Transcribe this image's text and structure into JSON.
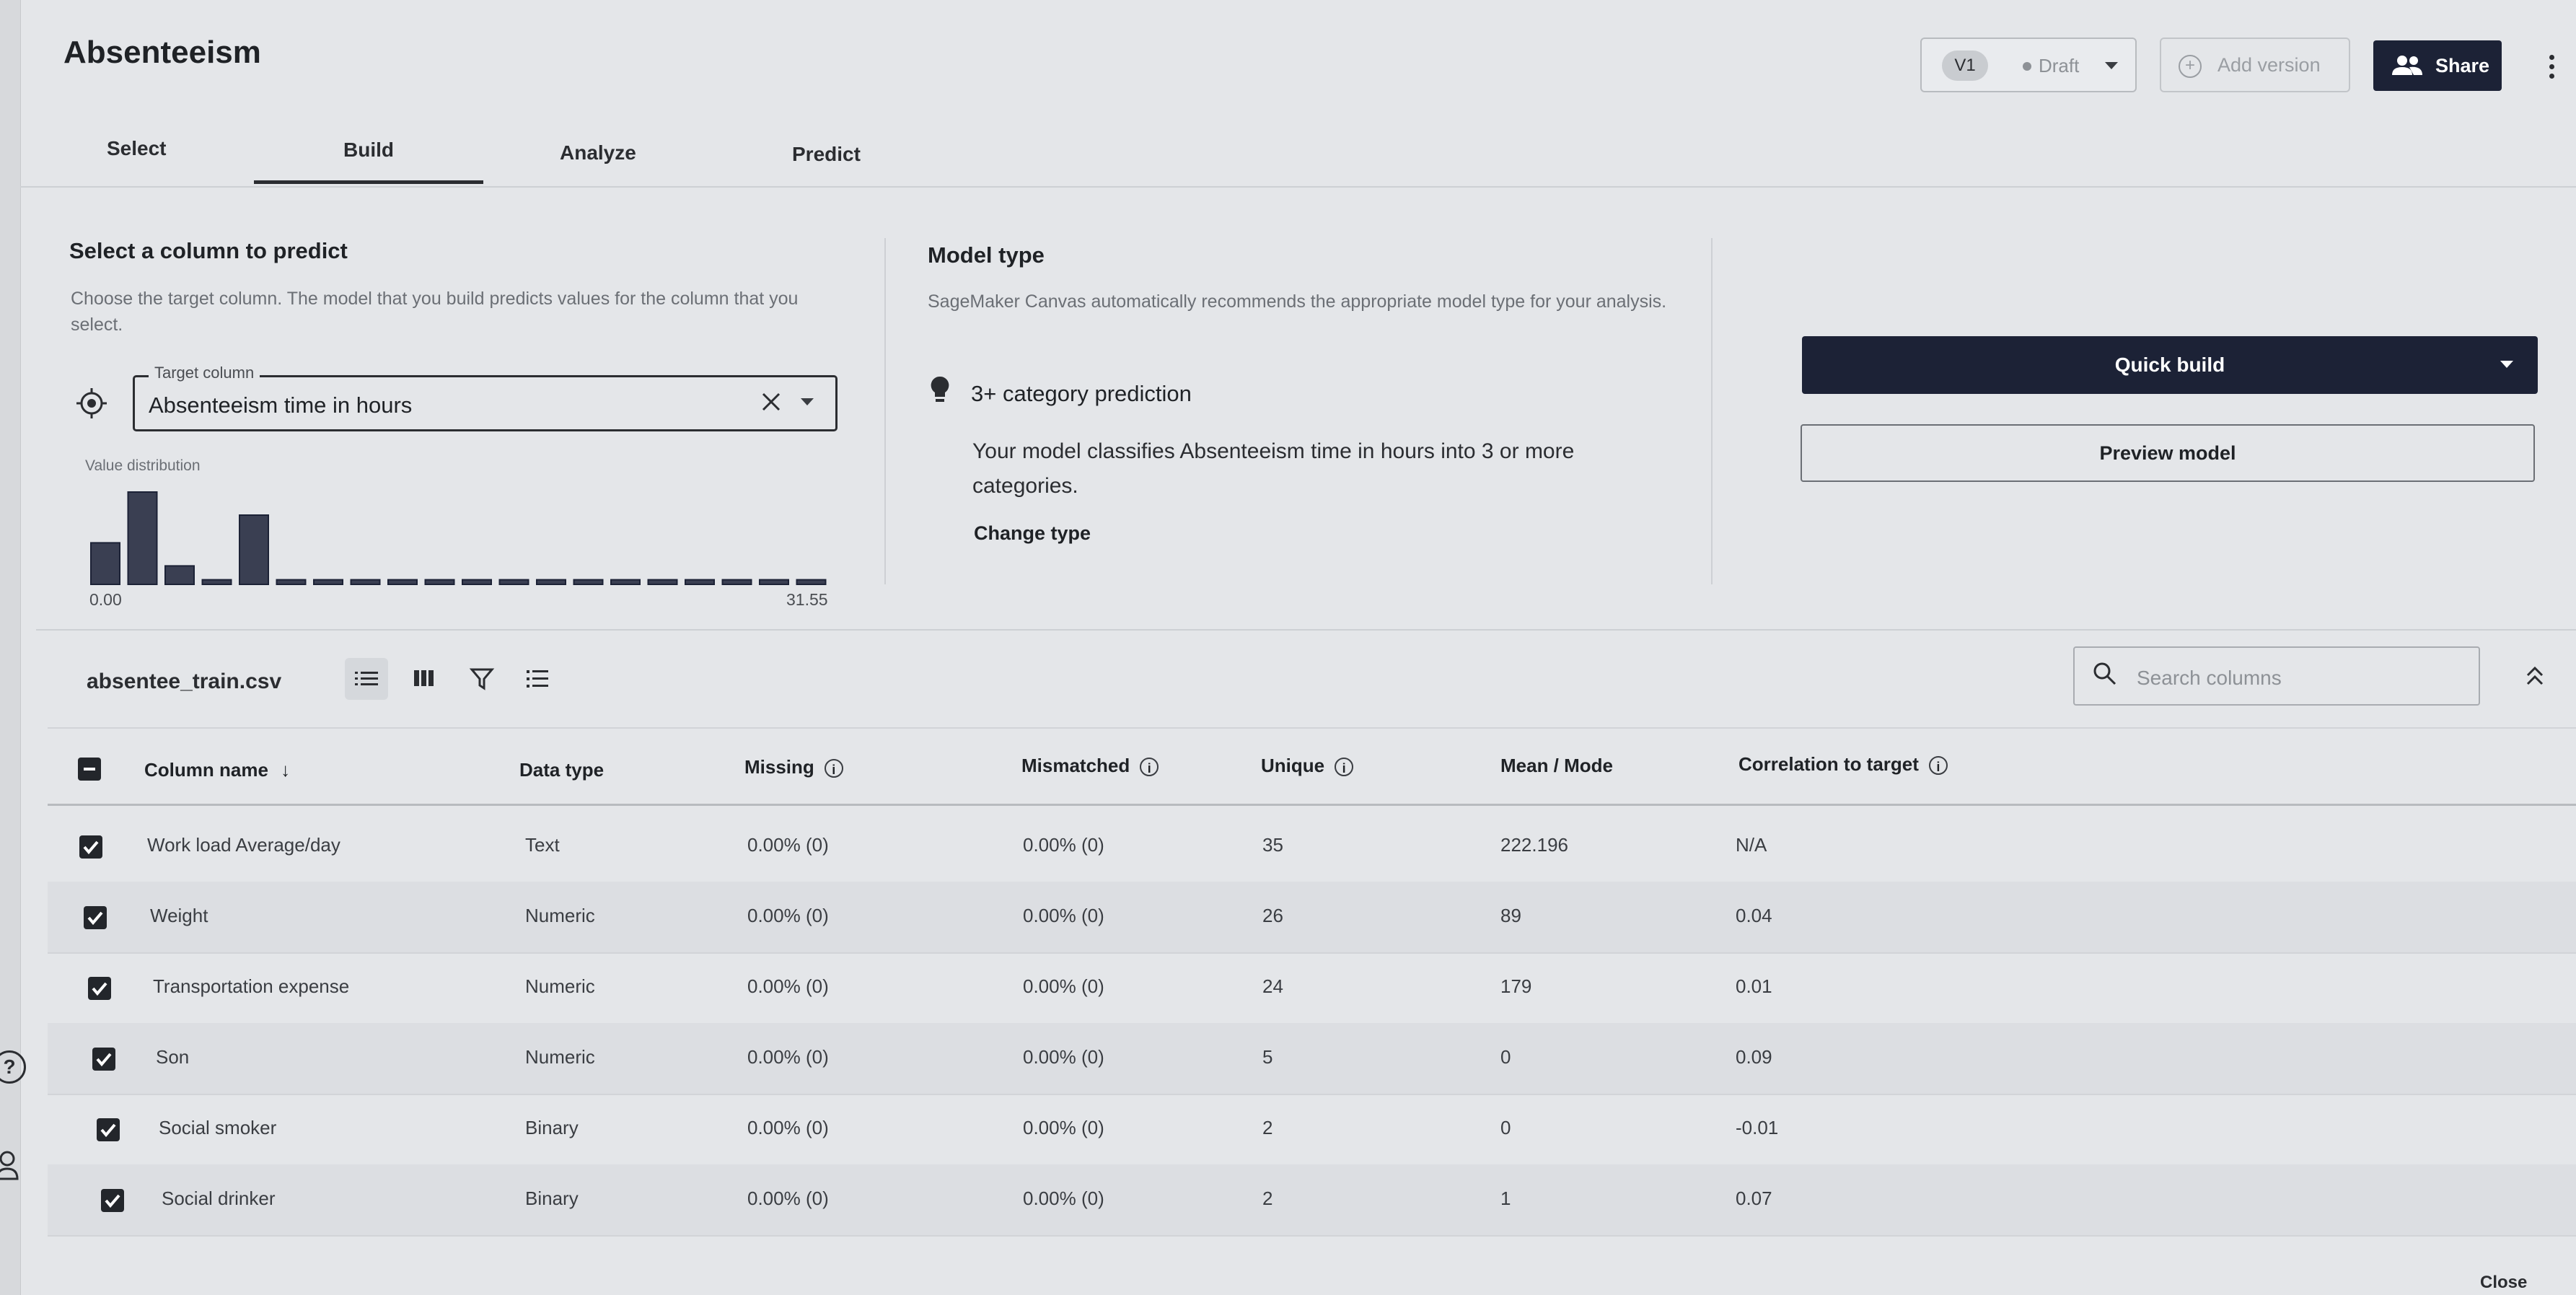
{
  "app": {
    "title": "Absenteeism"
  },
  "header": {
    "version_label": "V1",
    "status_label": "Draft",
    "add_version_label": "Add version",
    "share_label": "Share"
  },
  "tabs": [
    {
      "label": "Select"
    },
    {
      "label": "Build",
      "active": true
    },
    {
      "label": "Analyze"
    },
    {
      "label": "Predict"
    }
  ],
  "target": {
    "title": "Select a column to predict",
    "description": "Choose the target column. The model that you build predicts values for the column that you select.",
    "field_label": "Target column",
    "value": "Absenteeism time in hours",
    "distribution_label": "Value distribution",
    "hist_min": "0.00",
    "hist_max": "31.55",
    "hist_values": [
      0.45,
      1.0,
      0.2,
      0.05,
      0.75,
      0.05,
      0.05,
      0.05,
      0.05,
      0.05,
      0.05,
      0.05,
      0.05,
      0.05,
      0.05,
      0.05,
      0.05,
      0.05,
      0.05,
      0.05
    ]
  },
  "model_type": {
    "title": "Model type",
    "description": "SageMaker Canvas automatically recommends the appropriate model type for your analysis.",
    "prediction_type": "3+ category prediction",
    "explanation": "Your model classifies Absenteeism time in hours into 3 or more categories.",
    "change_label": "Change type"
  },
  "actions": {
    "quick_build_label": "Quick build",
    "preview_label": "Preview model"
  },
  "dataset": {
    "file_name": "absentee_train.csv",
    "search_placeholder": "Search columns"
  },
  "table": {
    "headers": {
      "column_name": "Column name",
      "data_type": "Data type",
      "missing": "Missing",
      "mismatched": "Mismatched",
      "unique": "Unique",
      "mean_mode": "Mean / Mode",
      "correlation": "Correlation to target"
    },
    "rows": [
      {
        "name": "Work load Average/day",
        "type": "Text",
        "missing": "0.00% (0)",
        "mismatched": "0.00% (0)",
        "unique": "35",
        "mean": "222.196",
        "corr": "N/A"
      },
      {
        "name": "Weight",
        "type": "Numeric",
        "missing": "0.00% (0)",
        "mismatched": "0.00% (0)",
        "unique": "26",
        "mean": "89",
        "corr": "0.04"
      },
      {
        "name": "Transportation expense",
        "type": "Numeric",
        "missing": "0.00% (0)",
        "mismatched": "0.00% (0)",
        "unique": "24",
        "mean": "179",
        "corr": "0.01"
      },
      {
        "name": "Son",
        "type": "Numeric",
        "missing": "0.00% (0)",
        "mismatched": "0.00% (0)",
        "unique": "5",
        "mean": "0",
        "corr": "0.09"
      },
      {
        "name": "Social smoker",
        "type": "Binary",
        "missing": "0.00% (0)",
        "mismatched": "0.00% (0)",
        "unique": "2",
        "mean": "0",
        "corr": "-0.01"
      },
      {
        "name": "Social drinker",
        "type": "Binary",
        "missing": "0.00% (0)",
        "mismatched": "0.00% (0)",
        "unique": "2",
        "mean": "1",
        "corr": "0.07"
      }
    ]
  },
  "footer": {
    "close_label": "Close"
  },
  "colors": {
    "primary": "#1c2236",
    "background": "#e4e6e9",
    "checkbox": "#23262b"
  }
}
